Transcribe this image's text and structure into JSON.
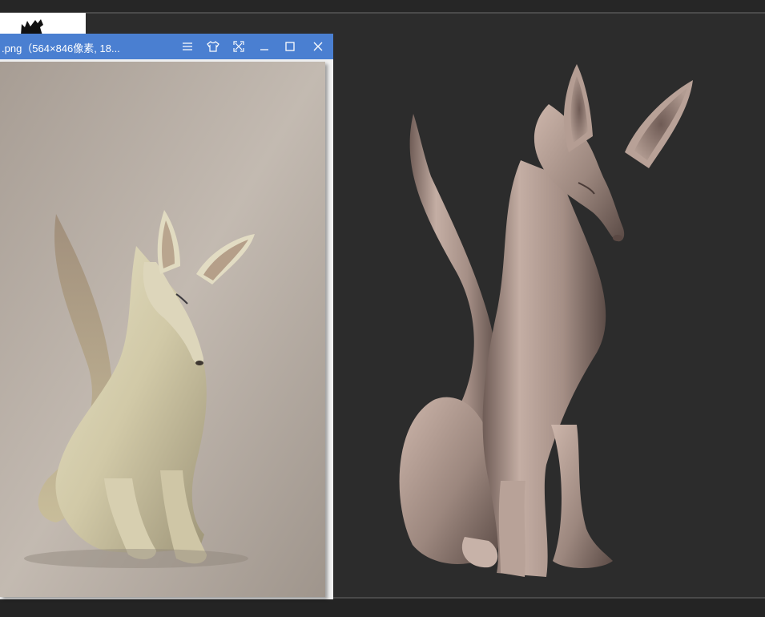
{
  "viewer": {
    "title": ".png（564×846像素, 18...",
    "buttons": {
      "menu": "menu-icon",
      "skin": "shirt-icon",
      "fit": "fit-screen-icon",
      "minimize": "minimize-icon",
      "maximize": "maximize-icon",
      "close": "close-icon"
    }
  },
  "colors": {
    "titlebar": "#4a7fd1",
    "workspace": "#2c2c2c",
    "model_clay": "#a58f86"
  }
}
